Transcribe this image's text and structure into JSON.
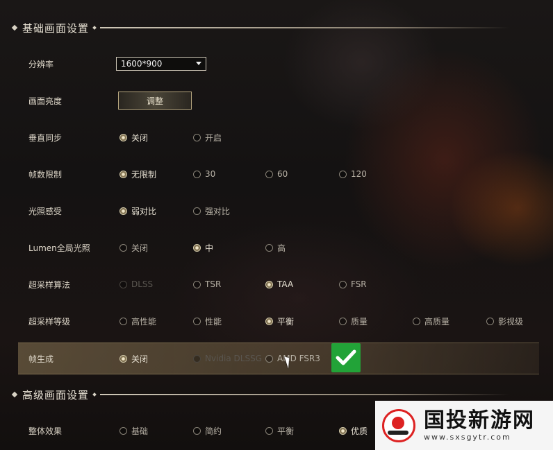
{
  "sections": {
    "basic_title": "基础画面设置",
    "advanced_title": "高级画面设置"
  },
  "rows": {
    "resolution": {
      "label": "分辨率",
      "value": "1600*900"
    },
    "brightness": {
      "label": "画面亮度",
      "button": "调整"
    },
    "vsync": {
      "label": "垂直同步",
      "options": [
        "关闭",
        "开启"
      ],
      "selected": "关闭"
    },
    "framerate": {
      "label": "帧数限制",
      "options": [
        "无限制",
        "30",
        "60",
        "120"
      ],
      "selected": "无限制"
    },
    "lighting": {
      "label": "光照感受",
      "options": [
        "弱对比",
        "强对比"
      ],
      "selected": "弱对比"
    },
    "lumen": {
      "label": "Lumen全局光照",
      "options": [
        "关闭",
        "中",
        "高"
      ],
      "selected": "中"
    },
    "upscale_algo": {
      "label": "超采样算法",
      "options": [
        "DLSS",
        "TSR",
        "TAA",
        "FSR"
      ],
      "selected": "TAA",
      "disabled": [
        "DLSS"
      ]
    },
    "upscale_level": {
      "label": "超采样等级",
      "options": [
        "高性能",
        "性能",
        "平衡",
        "质量",
        "高质量",
        "影视级"
      ],
      "selected": "平衡"
    },
    "frame_gen": {
      "label": "帧生成",
      "options": [
        "关闭",
        "Nvidia DLSSG",
        "AMD FSR3"
      ],
      "selected": "关闭",
      "disabled": [
        "Nvidia DLSSG"
      ]
    },
    "overall": {
      "label": "整体效果",
      "options": [
        "基础",
        "简约",
        "平衡",
        "优质"
      ],
      "selected": "优质"
    }
  },
  "badge": {
    "icon": "checkmark-icon",
    "color": "#22a338"
  },
  "watermark": {
    "name": "国投新游网",
    "url": "www.sxsgytr.com"
  }
}
